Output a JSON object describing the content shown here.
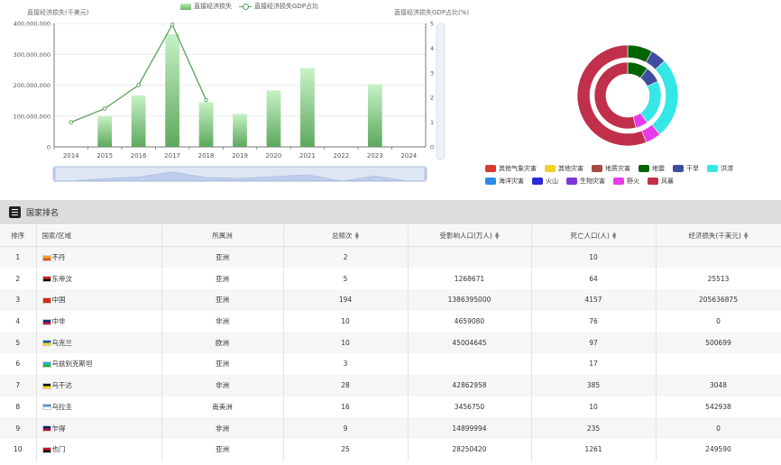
{
  "chart_data": [
    {
      "type": "bar",
      "legend": [
        "直接经济损失",
        "直接经济损失GDP占比"
      ],
      "ylabel": "直接经济损失(千美元)",
      "ylabel_right": "直接经济损失GDP占比(%)",
      "categories": [
        "2014",
        "2015",
        "2016",
        "2017",
        "2018",
        "2019",
        "2020",
        "2021",
        "2022",
        "2023",
        "2024"
      ],
      "series": [
        {
          "name": "直接经济损失",
          "type": "bar",
          "values": [
            0,
            100000000,
            167000000,
            365000000,
            145000000,
            107000000,
            183000000,
            255000000,
            0,
            203000000,
            0
          ]
        },
        {
          "name": "直接经济损失GDP占比",
          "type": "line",
          "values": [
            1.0,
            1.55,
            2.5,
            4.95,
            1.9,
            null,
            null,
            null,
            null,
            null,
            null
          ]
        }
      ],
      "ylim": [
        0,
        400000000
      ],
      "yticks": [
        "0",
        "100,000,000",
        "200,000,000",
        "300,000,000",
        "400,000,000"
      ],
      "ylim_right": [
        0,
        5
      ],
      "yticks_right": [
        "0",
        "1",
        "2",
        "3",
        "4",
        "5"
      ]
    },
    {
      "type": "pie",
      "legend": [
        "其他气象灾害",
        "其他灾害",
        "地质灾害",
        "地震",
        "干旱",
        "洪涝",
        "海洋灾害",
        "火山",
        "生物灾害",
        "野火",
        "风暴"
      ],
      "colors": [
        "#d93a2b",
        "#f2d02e",
        "#a54a43",
        "#006400",
        "#3f4d9e",
        "#35e6e6",
        "#2f8be8",
        "#2a2ad6",
        "#7d3ad9",
        "#e83ae8",
        "#c0304a"
      ],
      "outer_ring": [
        {
          "name": "地震",
          "value": 8
        },
        {
          "name": "干旱",
          "value": 5
        },
        {
          "name": "洪涝",
          "value": 26
        },
        {
          "name": "野火",
          "value": 5
        },
        {
          "name": "风暴",
          "value": 56
        }
      ],
      "inner_ring": [
        {
          "name": "地震",
          "value": 10
        },
        {
          "name": "干旱",
          "value": 8
        },
        {
          "name": "洪涝",
          "value": 22
        },
        {
          "name": "野火",
          "value": 6
        },
        {
          "name": "风暴",
          "value": 54
        }
      ]
    }
  ],
  "ranking": {
    "title": "国家排名",
    "columns": [
      "排序",
      "国家/区域",
      "所属洲",
      "总频次",
      "受影响人口(万人)",
      "死亡人口(人)",
      "经济损失(千美元)"
    ],
    "rows": [
      {
        "rank": "1",
        "country": "不丹",
        "continent": "亚洲",
        "freq": "2",
        "affected": "",
        "deaths": "10",
        "loss": "",
        "flag": [
          "#f6a21d",
          "#e7532b"
        ]
      },
      {
        "rank": "2",
        "country": "东帝汶",
        "continent": "亚洲",
        "freq": "5",
        "affected": "1268671",
        "deaths": "64",
        "loss": "25513",
        "flag": [
          "#dc241f",
          "#111111"
        ]
      },
      {
        "rank": "3",
        "country": "中国",
        "continent": "亚洲",
        "freq": "194",
        "affected": "1386395000",
        "deaths": "4157",
        "loss": "205636875",
        "flag": [
          "#de2910",
          "#de2910"
        ]
      },
      {
        "rank": "4",
        "country": "中非",
        "continent": "非洲",
        "freq": "10",
        "affected": "4659080",
        "deaths": "76",
        "loss": "0",
        "flag": [
          "#003082",
          "#d21034"
        ]
      },
      {
        "rank": "5",
        "country": "乌克兰",
        "continent": "欧洲",
        "freq": "10",
        "affected": "45004645",
        "deaths": "97",
        "loss": "500699",
        "flag": [
          "#0057b7",
          "#ffd700"
        ]
      },
      {
        "rank": "6",
        "country": "乌兹别克斯坦",
        "continent": "亚洲",
        "freq": "3",
        "affected": "",
        "deaths": "17",
        "loss": "",
        "flag": [
          "#1eb5e6",
          "#1eb53a"
        ]
      },
      {
        "rank": "7",
        "country": "乌干达",
        "continent": "非洲",
        "freq": "28",
        "affected": "42862958",
        "deaths": "385",
        "loss": "3048",
        "flag": [
          "#111111",
          "#fcdc04"
        ]
      },
      {
        "rank": "8",
        "country": "乌拉圭",
        "continent": "南美洲",
        "freq": "16",
        "affected": "3456750",
        "deaths": "10",
        "loss": "542938",
        "flag": [
          "#5b8fd6",
          "#ffffff"
        ]
      },
      {
        "rank": "9",
        "country": "乍得",
        "continent": "非洲",
        "freq": "9",
        "affected": "14899994",
        "deaths": "235",
        "loss": "0",
        "flag": [
          "#002664",
          "#c60c30"
        ]
      },
      {
        "rank": "10",
        "country": "也门",
        "continent": "亚洲",
        "freq": "25",
        "affected": "28250420",
        "deaths": "1261",
        "loss": "249590",
        "flag": [
          "#ce1126",
          "#111111"
        ]
      }
    ]
  }
}
